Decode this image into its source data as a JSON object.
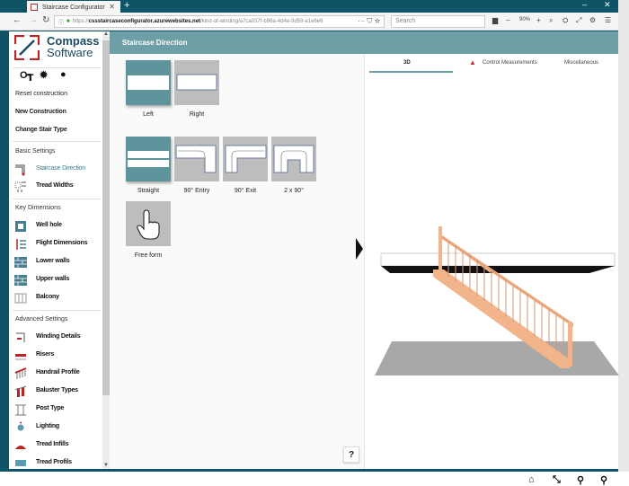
{
  "browser": {
    "tab_title": "Staircase Configurator",
    "new_tab": "+",
    "url_prefix": "https://",
    "url_host": "cssstaircaseconfigurator.azurewebsites.net",
    "url_path": "/kind-of-winding/a7ca037f-b96a-4d4e-9d59-e1e6e6",
    "search_placeholder": "Search",
    "zoom_level": "90%",
    "minimize": "–",
    "close": "✕"
  },
  "sidebar": {
    "logo_line1": "Compass",
    "logo_line2": "Software",
    "actions": [
      "Reset construction",
      "New Construction",
      "Change Stair Type"
    ],
    "sections": [
      {
        "title": "Basic Settings",
        "items": [
          {
            "label": "Staircase Direction",
            "icon": "direction-icon",
            "active": true
          },
          {
            "label": "Tread Widths",
            "icon": "tread-widths-icon"
          }
        ]
      },
      {
        "title": "Key Dimensions",
        "items": [
          {
            "label": "Well hole",
            "icon": "well-hole-icon"
          },
          {
            "label": "Flight Dimensions",
            "icon": "flight-dimensions-icon"
          },
          {
            "label": "Lower walls",
            "icon": "lower-walls-icon"
          },
          {
            "label": "Upper walls",
            "icon": "upper-walls-icon"
          },
          {
            "label": "Balcony",
            "icon": "balcony-icon"
          }
        ]
      },
      {
        "title": "Advanced Settings",
        "items": [
          {
            "label": "Winding Details",
            "icon": "winding-icon"
          },
          {
            "label": "Risers",
            "icon": "risers-icon"
          },
          {
            "label": "Handrail Profile",
            "icon": "handrail-icon"
          },
          {
            "label": "Baluster Types",
            "icon": "baluster-icon"
          },
          {
            "label": "Post Type",
            "icon": "post-icon"
          },
          {
            "label": "Lighting",
            "icon": "lighting-icon"
          },
          {
            "label": "Tread Infills",
            "icon": "tread-infill-icon"
          },
          {
            "label": "Tread Profils",
            "icon": "tread-profile-icon"
          }
        ]
      }
    ]
  },
  "panel": {
    "title": "Staircase Direction",
    "directions": [
      {
        "label": "Left",
        "selected": true
      },
      {
        "label": "Right",
        "selected": false
      }
    ],
    "shapes": [
      {
        "label": "Straight",
        "selected": true
      },
      {
        "label": "90° Entry",
        "selected": false
      },
      {
        "label": "90° Exit",
        "selected": false
      },
      {
        "label": "2 x 90°",
        "selected": false
      },
      {
        "label": "Free form",
        "selected": false
      }
    ],
    "help": "?"
  },
  "viewer": {
    "tabs": [
      {
        "label": "3D",
        "active": true
      },
      {
        "label": "Control Measurements",
        "warning": true
      },
      {
        "label": "Miscellaneous"
      }
    ],
    "colors": {
      "accent": "#6e9fa6",
      "wood": "#f2b48a",
      "warning": "#c0313f"
    }
  }
}
